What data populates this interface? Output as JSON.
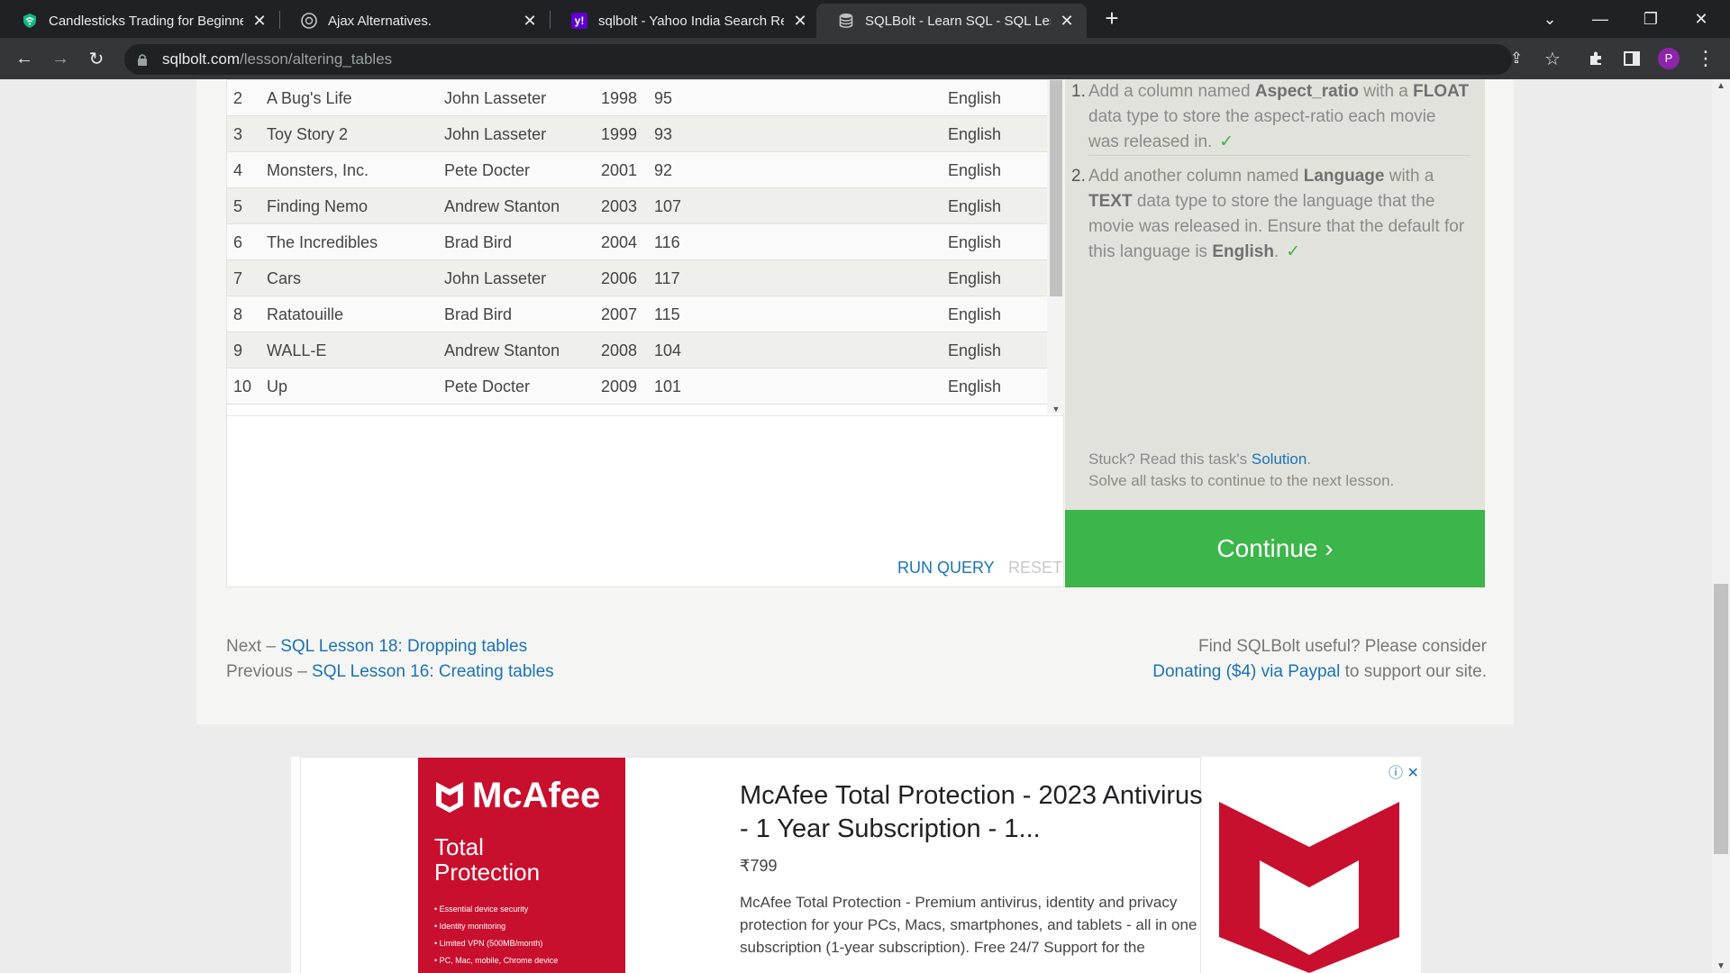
{
  "tabs": [
    {
      "title": "Candlesticks Trading for Beginne",
      "icon": "wifi-shield-icon"
    },
    {
      "title": "Ajax Alternatives.",
      "icon": "chatgpt-icon"
    },
    {
      "title": "sqlbolt - Yahoo India Search Resu",
      "icon": "yahoo-icon"
    },
    {
      "title": "SQLBolt - Learn SQL - SQL Lesso",
      "icon": "database-icon"
    }
  ],
  "toolbar": {
    "url_host": "sqlbolt.com",
    "url_path": "/lesson/altering_tables",
    "profile_initial": "P"
  },
  "results": {
    "rows": [
      {
        "id": "2",
        "title": "A Bug's Life",
        "director": "John Lasseter",
        "year": "1998",
        "length": "95",
        "language": "English"
      },
      {
        "id": "3",
        "title": "Toy Story 2",
        "director": "John Lasseter",
        "year": "1999",
        "length": "93",
        "language": "English"
      },
      {
        "id": "4",
        "title": "Monsters, Inc.",
        "director": "Pete Docter",
        "year": "2001",
        "length": "92",
        "language": "English"
      },
      {
        "id": "5",
        "title": "Finding Nemo",
        "director": "Andrew Stanton",
        "year": "2003",
        "length": "107",
        "language": "English"
      },
      {
        "id": "6",
        "title": "The Incredibles",
        "director": "Brad Bird",
        "year": "2004",
        "length": "116",
        "language": "English"
      },
      {
        "id": "7",
        "title": "Cars",
        "director": "John Lasseter",
        "year": "2006",
        "length": "117",
        "language": "English"
      },
      {
        "id": "8",
        "title": "Ratatouille",
        "director": "Brad Bird",
        "year": "2007",
        "length": "115",
        "language": "English"
      },
      {
        "id": "9",
        "title": "WALL-E",
        "director": "Andrew Stanton",
        "year": "2008",
        "length": "104",
        "language": "English"
      },
      {
        "id": "10",
        "title": "Up",
        "director": "Pete Docter",
        "year": "2009",
        "length": "101",
        "language": "English"
      }
    ]
  },
  "editor": {
    "run_label": "RUN QUERY",
    "reset_label": "RESET"
  },
  "tasks": {
    "task1": {
      "num": "1.",
      "pre": "Add a column named ",
      "b1": "Aspect_ratio",
      "mid": " with a ",
      "b2": "FLOAT",
      "post": " data type to store the aspect-ratio each movie was released in."
    },
    "task2": {
      "num": "2.",
      "pre": "Add another column named ",
      "b1": "Language",
      "mid": " with a ",
      "b2": "TEXT",
      "post": " data type to store the language that the movie was released in. Ensure that the default for this language is ",
      "b3": "English",
      "end": "."
    },
    "check": "✓",
    "stuck_pre": "Stuck? Read this task's ",
    "stuck_link": "Solution",
    "stuck_post": ".",
    "solve_note": "Solve all tasks to continue to the next lesson."
  },
  "continue_label": "Continue ›",
  "nav": {
    "next_prefix": "Next – ",
    "next_link": "SQL Lesson 18: Dropping tables",
    "prev_prefix": "Previous – ",
    "prev_link": "SQL Lesson 16: Creating tables",
    "donate_text": "Find SQLBolt useful? Please consider",
    "donate_link": "Donating ($4) via Paypal",
    "donate_suffix": " to support our site."
  },
  "ad": {
    "brand": "McAfee",
    "product_line1": "Total",
    "product_line2": "Protection",
    "bullets": [
      "• Essential device security",
      "• Identity monitoring",
      "• Limited VPN (500MB/month)",
      "• PC, Mac, mobile, Chrome device"
    ],
    "title": "McAfee Total Protection - 2023 Antivirus - 1 Year Subscription - 1...",
    "price": "₹799",
    "description": "McAfee Total Protection - Premium antivirus, identity and privacy protection for your PCs, Macs, smartphones, and tablets - all in one subscription (1-year subscription). Free 24/7 Support for the",
    "brand_color": "#c8102e"
  },
  "colors": {
    "accent": "#3cb54a",
    "link": "#1a73b8"
  }
}
